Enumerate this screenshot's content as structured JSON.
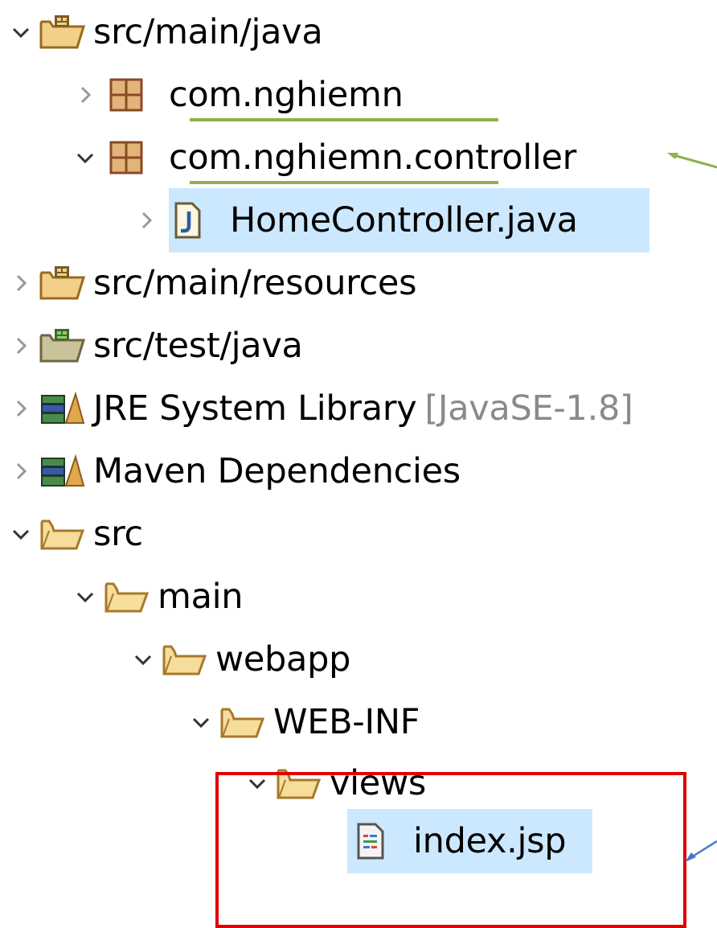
{
  "tree": {
    "items": [
      {
        "label": "src/main/java",
        "expanded": true,
        "icon": "source-folder-icon"
      },
      {
        "label": "com.nghiemn",
        "expanded": false,
        "icon": "package-icon"
      },
      {
        "label": "com.nghiemn.controller",
        "expanded": true,
        "icon": "package-icon"
      },
      {
        "label": "HomeController.java",
        "expanded": false,
        "icon": "java-file-icon",
        "selected": true
      },
      {
        "label": "src/main/resources",
        "expanded": false,
        "icon": "source-folder-icon"
      },
      {
        "label": "src/test/java",
        "expanded": false,
        "icon": "test-source-folder-icon"
      },
      {
        "label": "JRE System Library",
        "decoration": "[JavaSE-1.8]",
        "expanded": false,
        "icon": "library-icon"
      },
      {
        "label": "Maven Dependencies",
        "expanded": false,
        "icon": "library-icon"
      },
      {
        "label": "src",
        "expanded": true,
        "icon": "folder-icon"
      },
      {
        "label": "main",
        "expanded": true,
        "icon": "folder-icon"
      },
      {
        "label": "webapp",
        "expanded": true,
        "icon": "folder-icon"
      },
      {
        "label": "WEB-INF",
        "expanded": true,
        "icon": "folder-icon"
      },
      {
        "label": "views",
        "expanded": true,
        "icon": "folder-icon"
      },
      {
        "label": "index.jsp",
        "icon": "jsp-file-icon",
        "selected": true
      }
    ]
  },
  "colors": {
    "selection": "#cce8ff",
    "underline": "#8fb04a",
    "highlight_box": "#e00000",
    "arrow_green": "#8fb04a",
    "arrow_blue": "#4a78c8"
  }
}
